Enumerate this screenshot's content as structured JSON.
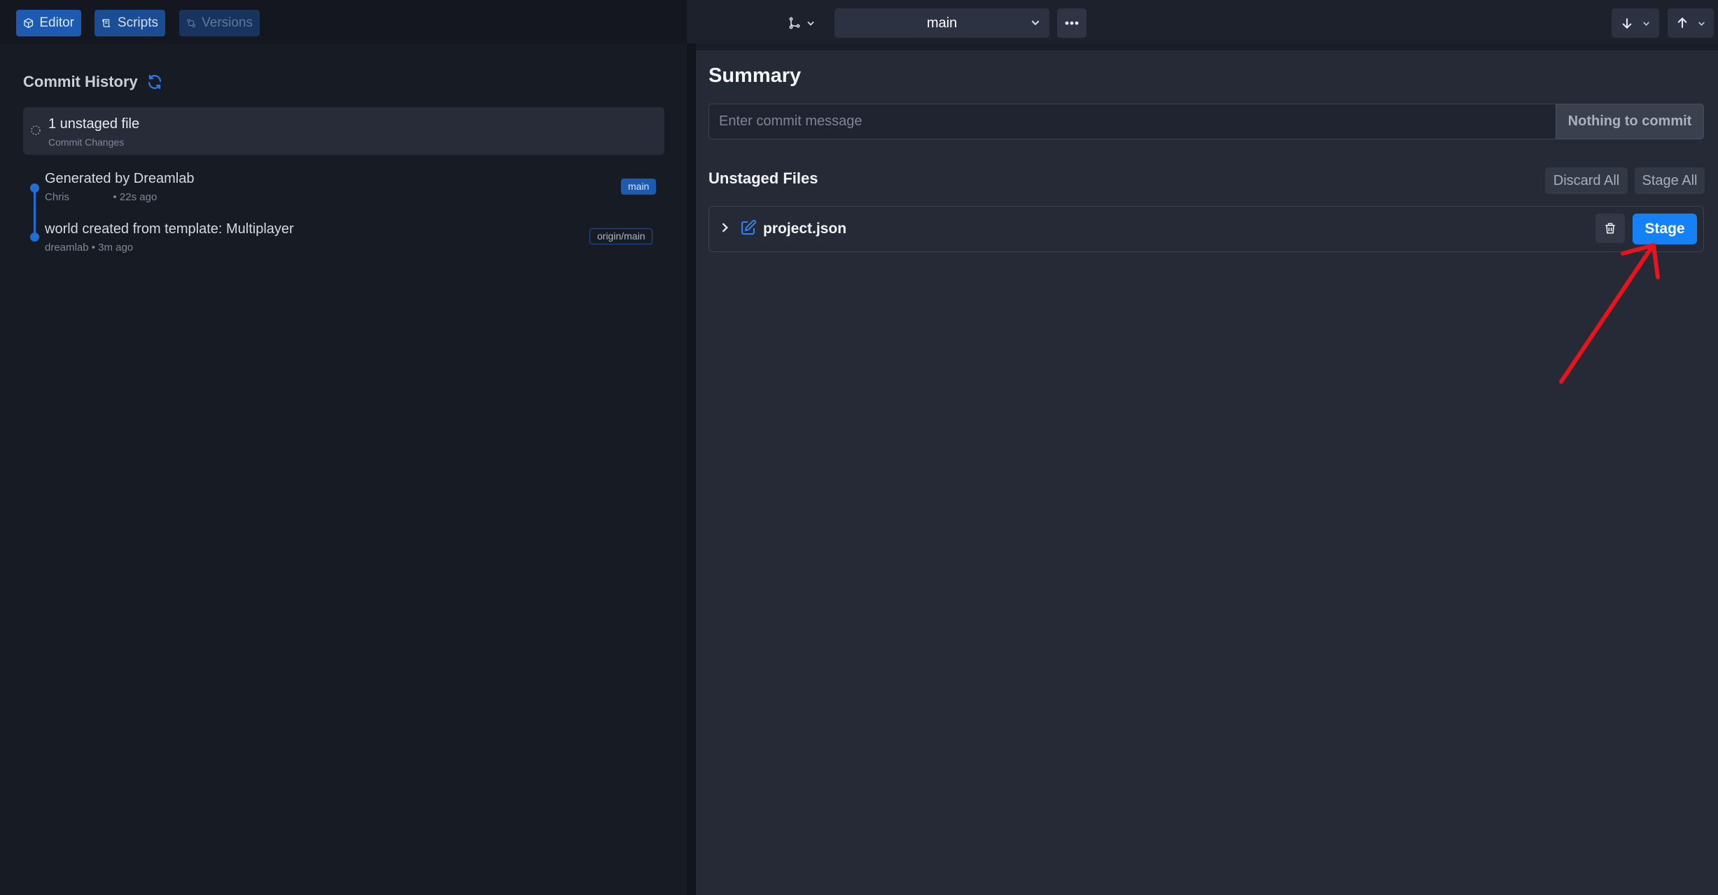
{
  "topbar": {
    "tabs": [
      {
        "label": "Editor",
        "icon": "cube-icon"
      },
      {
        "label": "Scripts",
        "icon": "scroll-icon"
      },
      {
        "label": "Versions",
        "icon": "git-compare-icon"
      }
    ],
    "branch": "main"
  },
  "history": {
    "title": "Commit History",
    "unstaged": {
      "title": "1 unstaged file",
      "subtitle": "Commit Changes"
    },
    "commits": [
      {
        "message": "Generated by Dreamlab",
        "meta": "Chris               • 22s ago",
        "badge": "main"
      },
      {
        "message": "world created from template: Multiplayer",
        "meta": "dreamlab • 3m ago",
        "badge": "origin/main"
      }
    ]
  },
  "summary": {
    "title": "Summary",
    "placeholder": "Enter commit message",
    "commit_label": "Nothing to commit"
  },
  "unstaged_files": {
    "title": "Unstaged Files",
    "discard_all": "Discard All",
    "stage_all": "Stage All",
    "files": [
      {
        "name": "project.json",
        "stage_label": "Stage"
      }
    ]
  },
  "colors": {
    "accent": "#1481f7",
    "annotation": "#e8141b"
  }
}
